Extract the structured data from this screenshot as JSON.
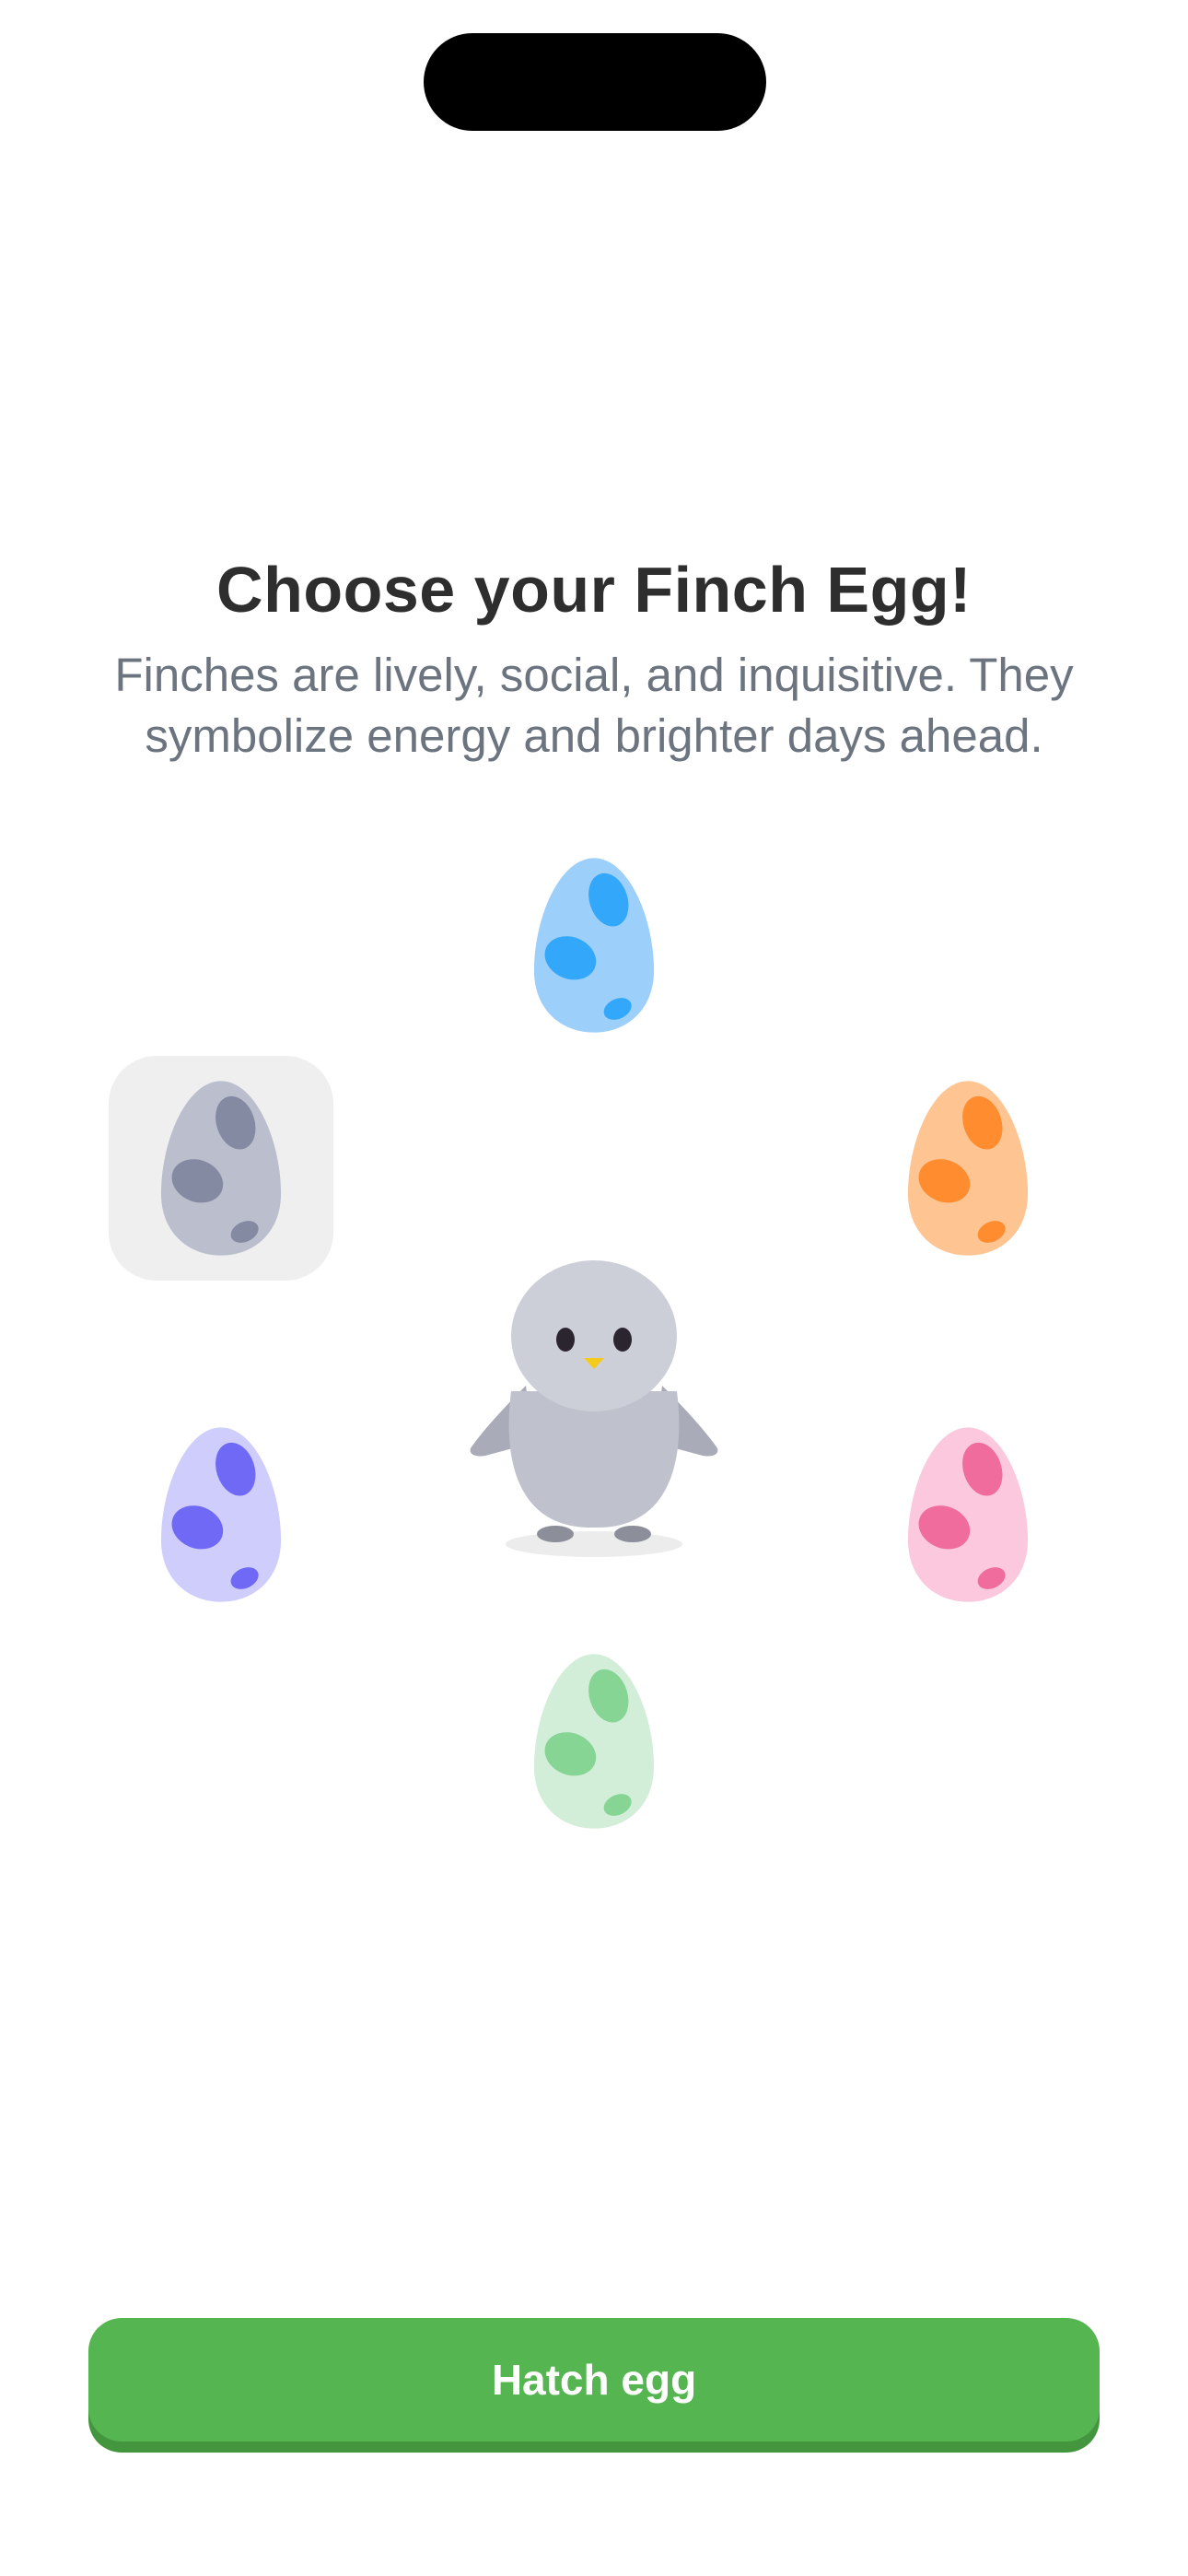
{
  "header": {
    "title": "Choose your Finch Egg!",
    "subtitle": "Finches are lively, social, and inquisitive. They symbolize energy and brighter days ahead."
  },
  "eggs": [
    {
      "id": "blue",
      "shell": "#9ccff9",
      "spot": "#33a7fa",
      "selected": false
    },
    {
      "id": "orange",
      "shell": "#fec492",
      "spot": "#ff8c2e",
      "selected": false
    },
    {
      "id": "pink",
      "shell": "#fbc8de",
      "spot": "#ef6c9d",
      "selected": false
    },
    {
      "id": "green",
      "shell": "#d3eed8",
      "spot": "#86d594",
      "selected": false
    },
    {
      "id": "purple",
      "shell": "#cfcdfc",
      "spot": "#6f69f5",
      "selected": false
    },
    {
      "id": "gray",
      "shell": "#bbbfcd",
      "spot": "#858aa3",
      "selected": true
    }
  ],
  "bird": {
    "icon": "finch-bird-icon",
    "body_color": "#bfc1cc"
  },
  "actions": {
    "hatch_label": "Hatch egg"
  },
  "colors": {
    "accent": "#55b550",
    "title": "#2e2e2e",
    "subtitle": "#6b747f"
  }
}
